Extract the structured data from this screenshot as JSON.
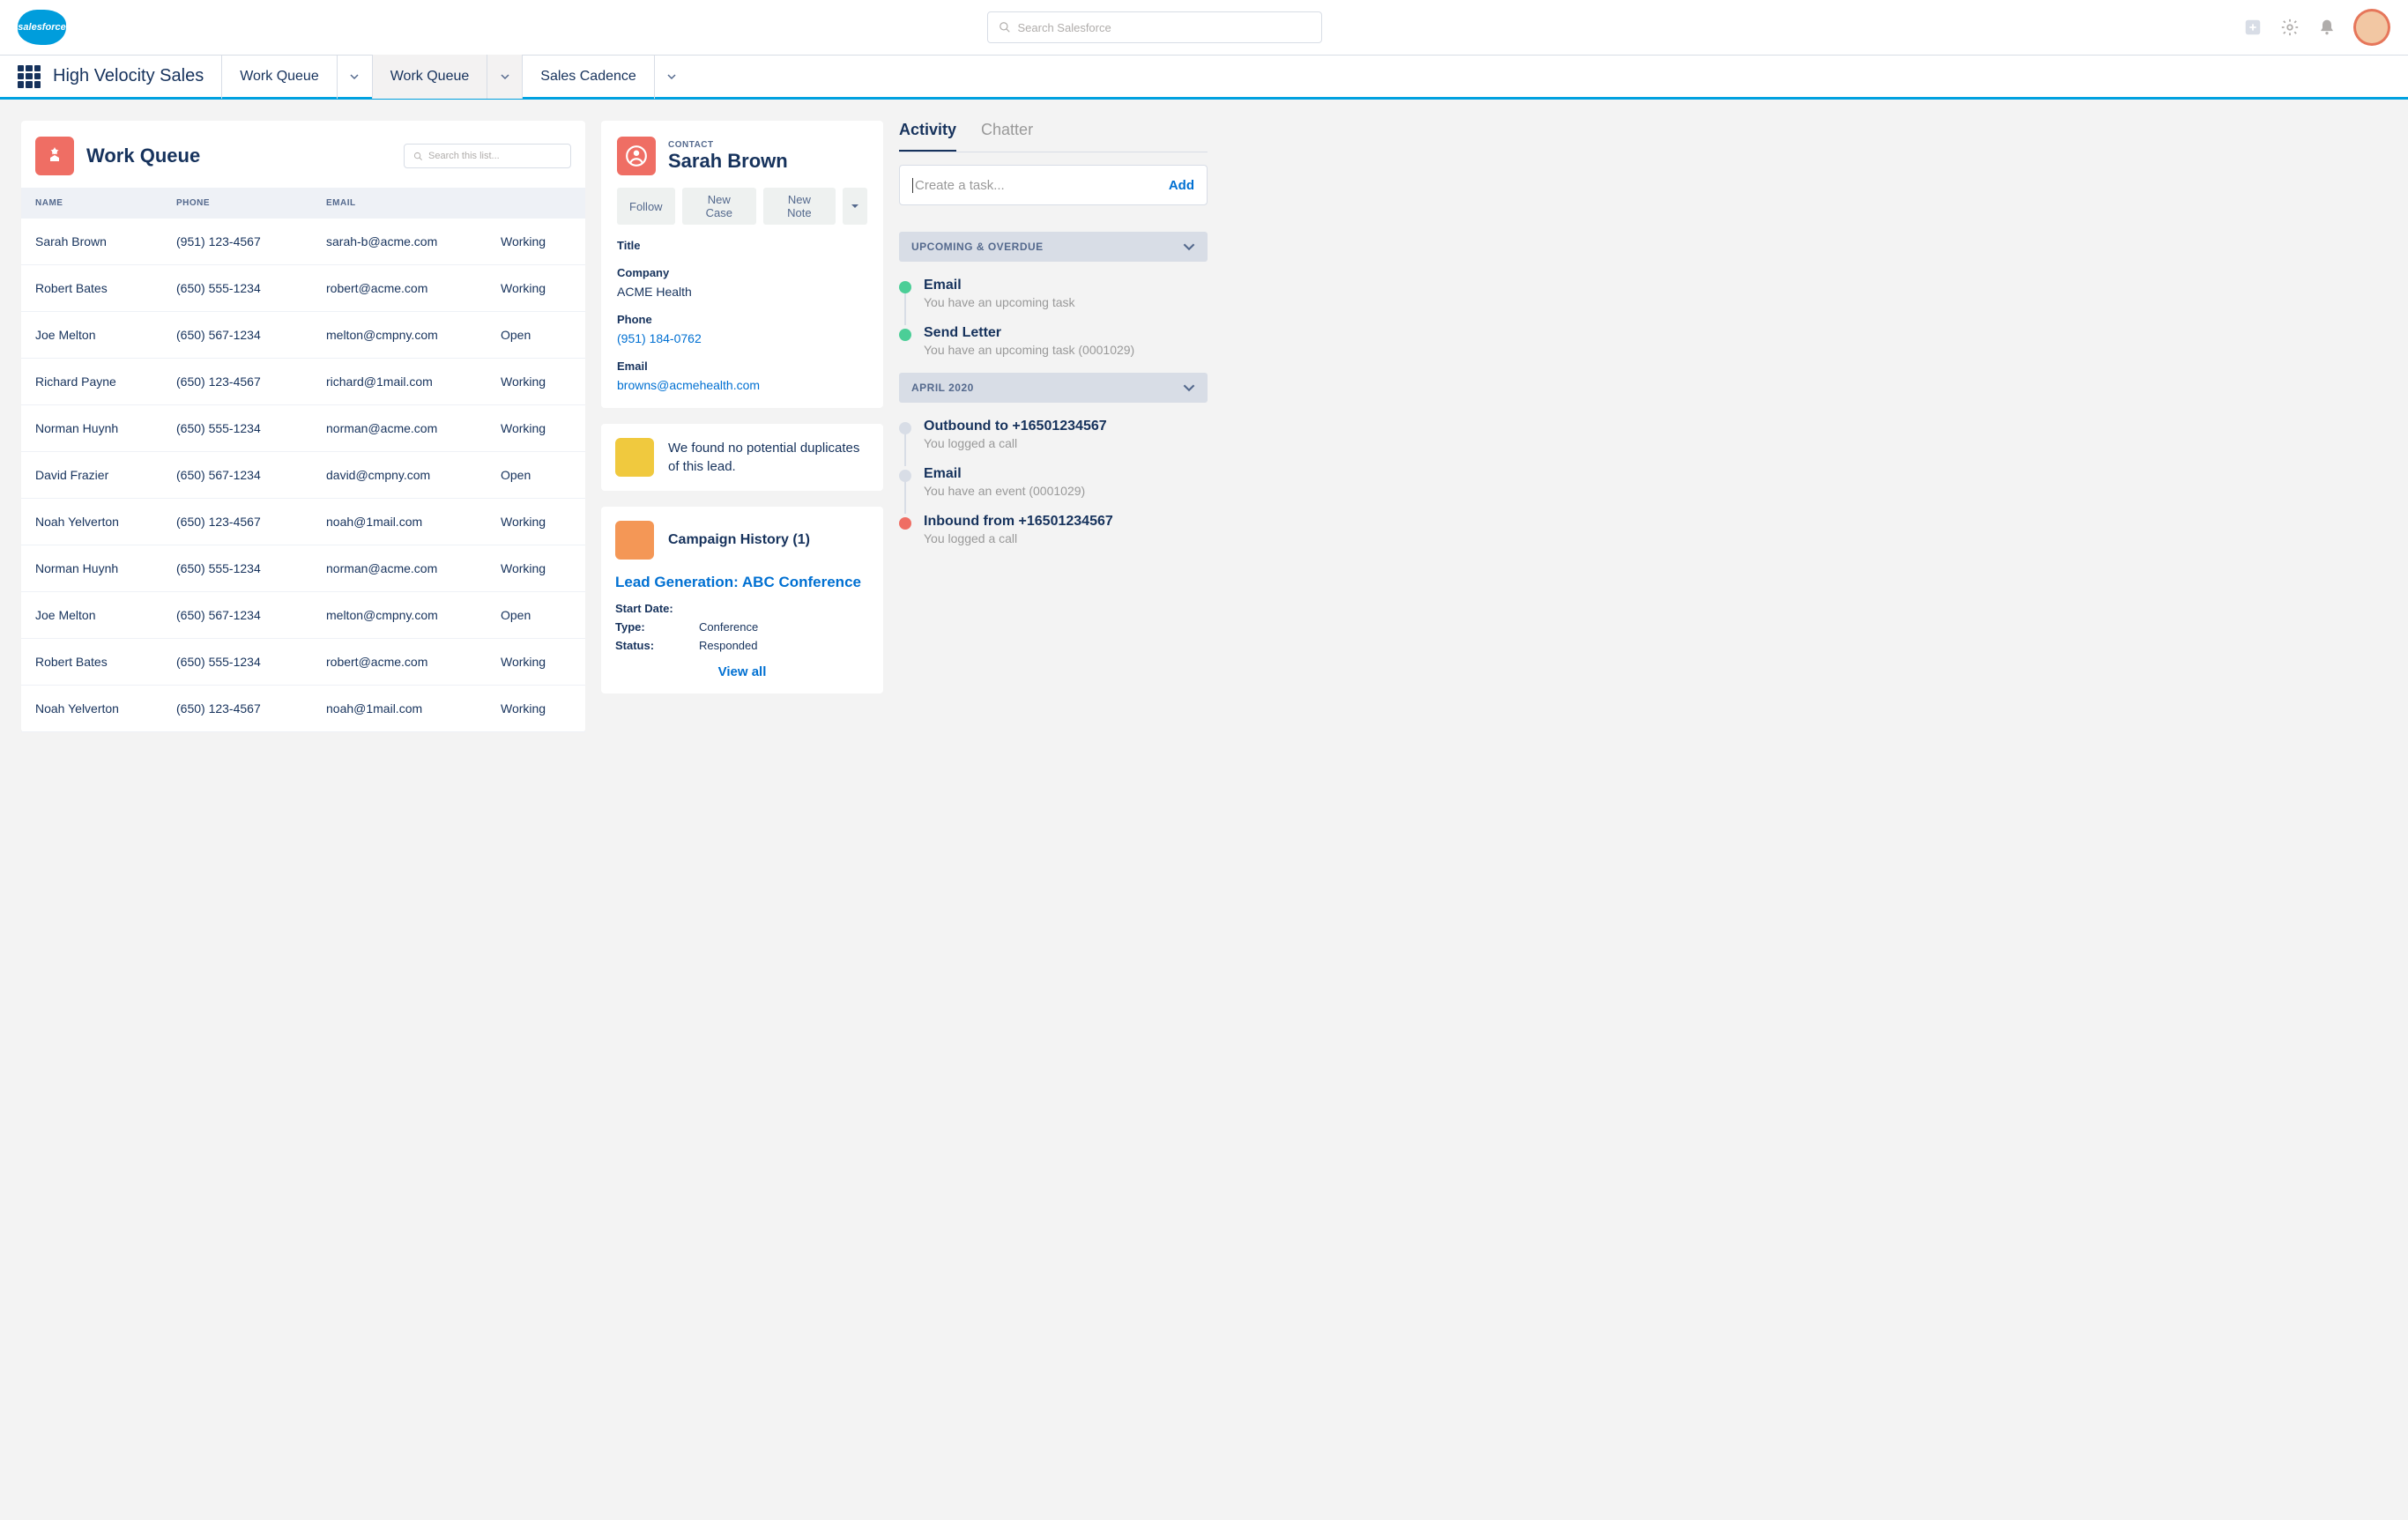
{
  "header": {
    "logo_text": "salesforce",
    "search_placeholder": "Search Salesforce"
  },
  "nav": {
    "app_title": "High Velocity Sales",
    "tabs": [
      {
        "label": "Work Queue",
        "active": false,
        "dropdown": true
      },
      {
        "label": "Work Queue",
        "active": true,
        "dropdown": true
      },
      {
        "label": "Sales Cadence",
        "active": false,
        "dropdown": true
      }
    ]
  },
  "work_queue": {
    "title": "Work Queue",
    "search_placeholder": "Search this list...",
    "columns": {
      "name": "NAME",
      "phone": "PHONE",
      "email": "EMAIL"
    },
    "rows": [
      {
        "name": "Sarah Brown",
        "phone": "(951) 123-4567",
        "email": "sarah-b@acme.com",
        "status": "Working"
      },
      {
        "name": "Robert Bates",
        "phone": "(650) 555-1234",
        "email": "robert@acme.com",
        "status": "Working"
      },
      {
        "name": "Joe Melton",
        "phone": "(650) 567-1234",
        "email": "melton@cmpny.com",
        "status": "Open"
      },
      {
        "name": "Richard Payne",
        "phone": "(650) 123-4567",
        "email": "richard@1mail.com",
        "status": "Working"
      },
      {
        "name": "Norman Huynh",
        "phone": "(650) 555-1234",
        "email": "norman@acme.com",
        "status": "Working"
      },
      {
        "name": "David Frazier",
        "phone": "(650) 567-1234",
        "email": "david@cmpny.com",
        "status": "Open"
      },
      {
        "name": "Noah Yelverton",
        "phone": "(650) 123-4567",
        "email": "noah@1mail.com",
        "status": "Working"
      },
      {
        "name": "Norman Huynh",
        "phone": "(650) 555-1234",
        "email": "norman@acme.com",
        "status": "Working"
      },
      {
        "name": "Joe Melton",
        "phone": "(650) 567-1234",
        "email": "melton@cmpny.com",
        "status": "Open"
      },
      {
        "name": "Robert Bates",
        "phone": "(650) 555-1234",
        "email": "robert@acme.com",
        "status": "Working"
      },
      {
        "name": "Noah Yelverton",
        "phone": "(650) 123-4567",
        "email": "noah@1mail.com",
        "status": "Working"
      }
    ]
  },
  "contact": {
    "object_label": "CONTACT",
    "name": "Sarah Brown",
    "actions": {
      "follow": "Follow",
      "new_case": "New Case",
      "new_note": "New Note"
    },
    "fields": {
      "title": {
        "label": "Title",
        "value": ""
      },
      "company": {
        "label": "Company",
        "value": "ACME Health"
      },
      "phone": {
        "label": "Phone",
        "value": "(951) 184-0762"
      },
      "email": {
        "label": "Email",
        "value": "browns@acmehealth.com"
      }
    },
    "duplicates_msg": "We found no potential duplicates of this lead.",
    "campaign": {
      "title": "Campaign History (1)",
      "link": "Lead Generation: ABC Conference",
      "start_date_label": "Start Date:",
      "start_date": "",
      "type_label": "Type:",
      "type": "Conference",
      "status_label": "Status:",
      "status": "Responded",
      "view_all": "View all"
    }
  },
  "activity": {
    "tabs": {
      "activity": "Activity",
      "chatter": "Chatter"
    },
    "task_placeholder": "Create a task...",
    "task_add": "Add",
    "sections": {
      "upcoming": "UPCOMING & OVERDUE",
      "april": "APRIL 2020"
    },
    "upcoming_items": [
      {
        "title": "Email",
        "sub": "You have an upcoming task",
        "dot": "green"
      },
      {
        "title": "Send Letter",
        "sub": "You have an upcoming task (0001029)",
        "dot": "green"
      }
    ],
    "past_items": [
      {
        "title": "Outbound to +16501234567",
        "sub": "You logged a call",
        "dot": "grey"
      },
      {
        "title": "Email",
        "sub": "You have an event (0001029)",
        "dot": "grey"
      },
      {
        "title": "Inbound from +16501234567",
        "sub": "You logged a call",
        "dot": "red"
      }
    ]
  }
}
